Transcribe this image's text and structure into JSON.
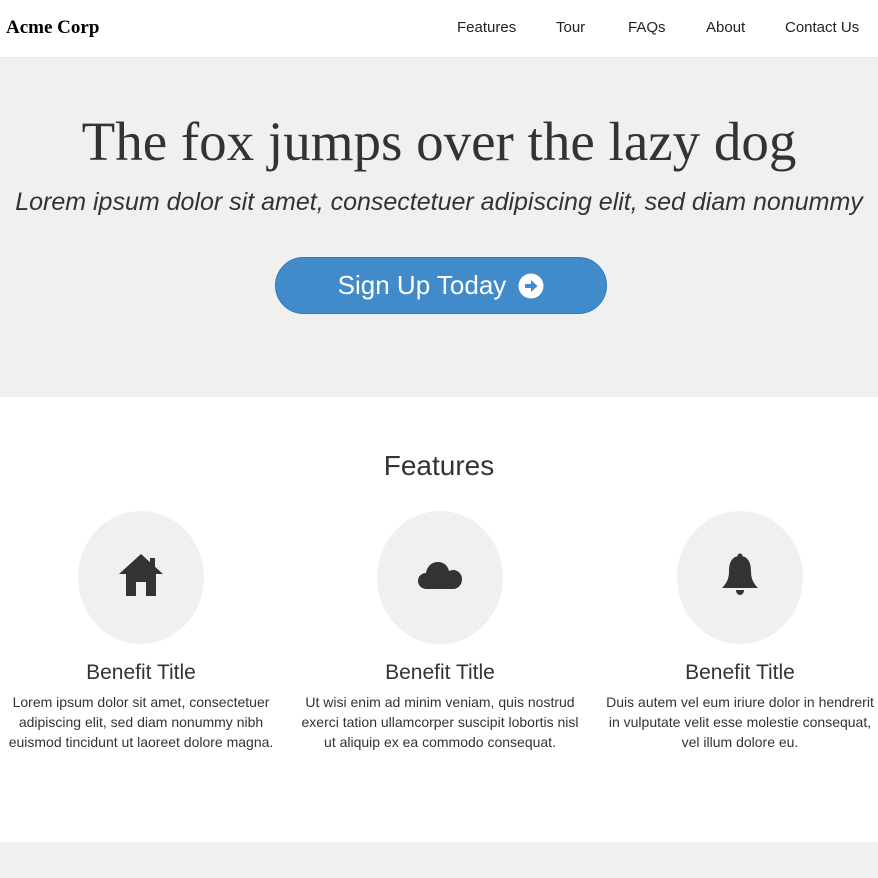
{
  "navbar": {
    "brand": "Acme Corp",
    "links": [
      "Features",
      "Tour",
      "FAQs",
      "About",
      "Contact Us"
    ]
  },
  "hero": {
    "title": "The fox jumps over the lazy dog",
    "subtitle": "Lorem ipsum dolor sit amet, consectetuer adipiscing elit, sed diam nonummy",
    "cta_label": "Sign Up Today",
    "cta_icon": "arrow-circle-right-icon",
    "cta_color": "#428bca"
  },
  "features": {
    "heading": "Features",
    "items": [
      {
        "icon": "home-icon",
        "title": "Benefit Title",
        "text": "Lorem ipsum dolor sit amet, consectetuer adipiscing elit, sed diam nonummy nibh euismod tincidunt ut laoreet dolore magna."
      },
      {
        "icon": "cloud-icon",
        "title": "Benefit Title",
        "text": "Ut wisi enim ad minim veniam, quis nostrud exerci tation ullamcorper suscipit lobortis nisl ut aliquip ex ea commodo consequat."
      },
      {
        "icon": "bell-icon",
        "title": "Benefit Title",
        "text": "Duis autem vel eum iriure dolor in hendrerit in vulputate velit esse molestie consequat, vel illum dolore eu."
      }
    ]
  },
  "colors": {
    "band_background": "#f0f0f0",
    "text": "#333333"
  }
}
